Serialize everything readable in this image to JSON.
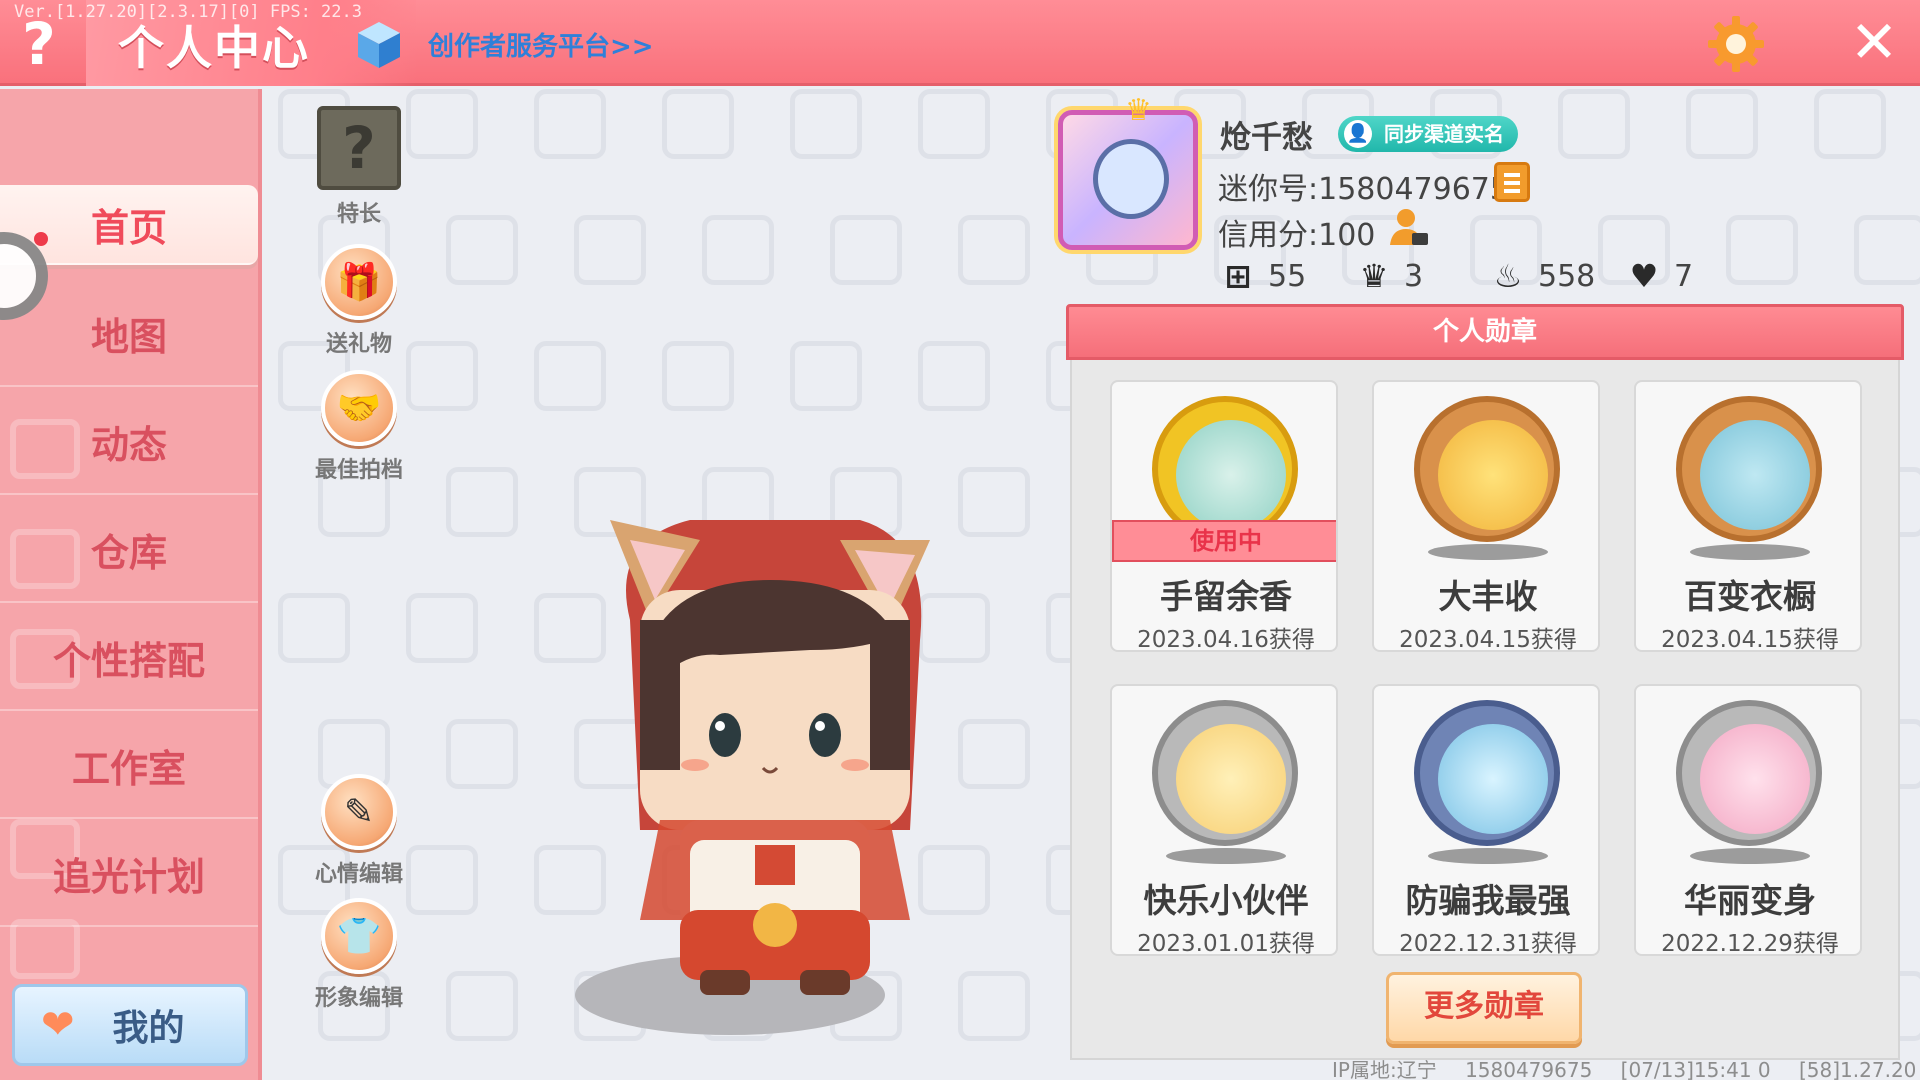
{
  "header": {
    "version_text": "Ver.[1.27.20][2.3.17][0] FPS: 22.3",
    "help_glyph": "?",
    "title": "个人中心",
    "creator_link": "创作者服务平台>>",
    "close_glyph": "✕"
  },
  "sidebar": {
    "items": [
      {
        "label": "首页",
        "active": true
      },
      {
        "label": "地图"
      },
      {
        "label": "动态"
      },
      {
        "label": "仓库"
      },
      {
        "label": "个性搭配"
      },
      {
        "label": "工作室"
      },
      {
        "label": "追光计划"
      }
    ],
    "mine_label": "我的"
  },
  "actions": {
    "special_label": "特长",
    "special_glyph": "?",
    "gift_label": "送礼物",
    "partner_label": "最佳拍档",
    "mood_label": "心情编辑",
    "image_label": "形象编辑"
  },
  "profile": {
    "username": "炝千愁",
    "verify_label": "同步渠道实名",
    "mini_id": "迷你号:1580479675",
    "credit": "信用分:100",
    "stats": {
      "likes": "55",
      "followers": "3",
      "popularity": "558",
      "hearts": "7"
    }
  },
  "medals": {
    "header": "个人勋章",
    "in_use_label": "使用中",
    "items": [
      {
        "name": "手留余香",
        "date": "2023.04.16获得",
        "in_use": true
      },
      {
        "name": "大丰收",
        "date": "2023.04.15获得"
      },
      {
        "name": "百变衣橱",
        "date": "2023.04.15获得"
      },
      {
        "name": "快乐小伙伴",
        "date": "2023.01.01获得"
      },
      {
        "name": "防骗我最强",
        "date": "2022.12.31获得"
      },
      {
        "name": "华丽变身",
        "date": "2022.12.29获得"
      }
    ],
    "more_label": "更多勋章"
  },
  "footer": {
    "ip_location": "IP属地:辽宁",
    "uid": "1580479675",
    "timestamp": "[07/13]15:41 0",
    "build": "[58]1.27.20"
  },
  "colors": {
    "header_pink": "#f9717c",
    "sidebar_pink": "#f6a5aa",
    "accent_red": "#f04b5b",
    "link_blue": "#2f80d9"
  }
}
